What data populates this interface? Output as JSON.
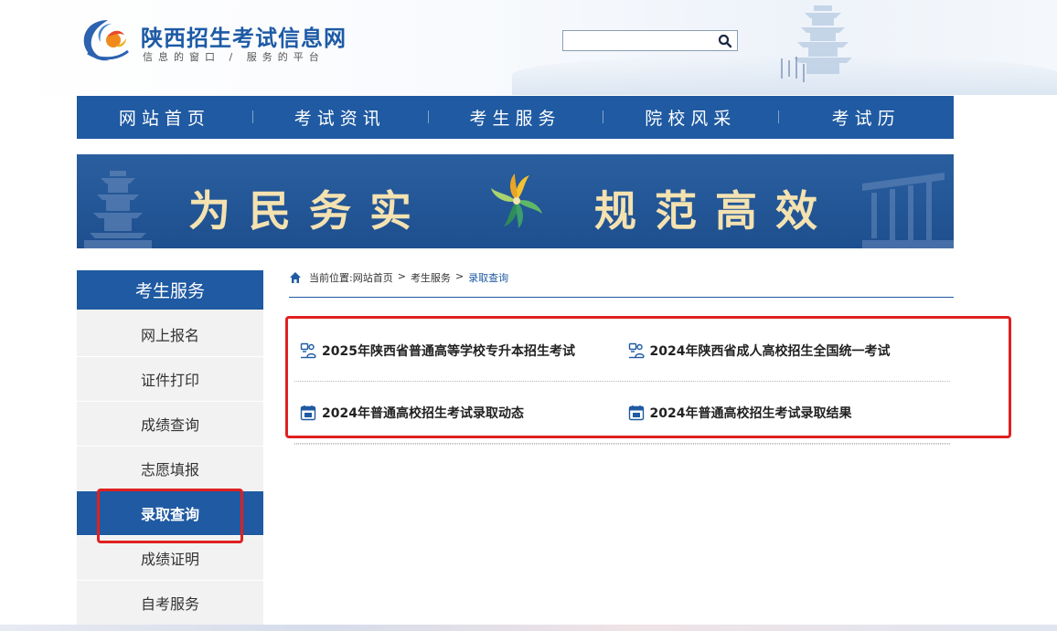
{
  "header": {
    "site_title": "陕西招生考试信息网",
    "slogan": "信息的窗口 / 服务的平台",
    "search": {
      "value": "",
      "placeholder": ""
    }
  },
  "nav": {
    "items": [
      {
        "label": "网站首页"
      },
      {
        "label": "考试资讯"
      },
      {
        "label": "考生服务"
      },
      {
        "label": "院校风采"
      },
      {
        "label": "考试历"
      }
    ]
  },
  "banner": {
    "left_text": "为民务实",
    "right_text": "规范高效"
  },
  "sidebar": {
    "title": "考生服务",
    "items": [
      {
        "label": "网上报名",
        "active": false
      },
      {
        "label": "证件打印",
        "active": false
      },
      {
        "label": "成绩查询",
        "active": false
      },
      {
        "label": "志愿填报",
        "active": false
      },
      {
        "label": "录取查询",
        "active": true
      },
      {
        "label": "成绩证明",
        "active": false
      },
      {
        "label": "自考服务",
        "active": false
      }
    ]
  },
  "breadcrumb": {
    "prefix": "当前位置:",
    "items": [
      "网站首页",
      "考生服务",
      "录取查询"
    ],
    "separator": ">"
  },
  "links": [
    {
      "label": "2025年陕西省普通高等学校专升本招生考试",
      "icon": "exam-person-icon"
    },
    {
      "label": "2024年陕西省成人高校招生全国统一考试",
      "icon": "exam-person-icon"
    },
    {
      "label": "2024年普通高校招生考试录取动态",
      "icon": "calendar-icon"
    },
    {
      "label": "2024年普通高校招生考试录取结果",
      "icon": "calendar-icon"
    }
  ],
  "colors": {
    "primary": "#1f5aa2",
    "highlight": "#e02020",
    "banner_text": "#f4e2b0",
    "sidebar_bg": "#f2f2f2"
  }
}
